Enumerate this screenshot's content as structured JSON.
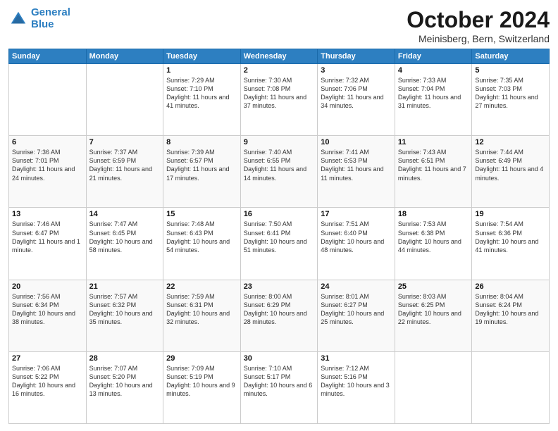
{
  "header": {
    "logo_line1": "General",
    "logo_line2": "Blue",
    "month": "October 2024",
    "location": "Meinisberg, Bern, Switzerland"
  },
  "weekdays": [
    "Sunday",
    "Monday",
    "Tuesday",
    "Wednesday",
    "Thursday",
    "Friday",
    "Saturday"
  ],
  "weeks": [
    [
      {
        "day": "",
        "info": ""
      },
      {
        "day": "",
        "info": ""
      },
      {
        "day": "1",
        "info": "Sunrise: 7:29 AM\nSunset: 7:10 PM\nDaylight: 11 hours and 41 minutes."
      },
      {
        "day": "2",
        "info": "Sunrise: 7:30 AM\nSunset: 7:08 PM\nDaylight: 11 hours and 37 minutes."
      },
      {
        "day": "3",
        "info": "Sunrise: 7:32 AM\nSunset: 7:06 PM\nDaylight: 11 hours and 34 minutes."
      },
      {
        "day": "4",
        "info": "Sunrise: 7:33 AM\nSunset: 7:04 PM\nDaylight: 11 hours and 31 minutes."
      },
      {
        "day": "5",
        "info": "Sunrise: 7:35 AM\nSunset: 7:03 PM\nDaylight: 11 hours and 27 minutes."
      }
    ],
    [
      {
        "day": "6",
        "info": "Sunrise: 7:36 AM\nSunset: 7:01 PM\nDaylight: 11 hours and 24 minutes."
      },
      {
        "day": "7",
        "info": "Sunrise: 7:37 AM\nSunset: 6:59 PM\nDaylight: 11 hours and 21 minutes."
      },
      {
        "day": "8",
        "info": "Sunrise: 7:39 AM\nSunset: 6:57 PM\nDaylight: 11 hours and 17 minutes."
      },
      {
        "day": "9",
        "info": "Sunrise: 7:40 AM\nSunset: 6:55 PM\nDaylight: 11 hours and 14 minutes."
      },
      {
        "day": "10",
        "info": "Sunrise: 7:41 AM\nSunset: 6:53 PM\nDaylight: 11 hours and 11 minutes."
      },
      {
        "day": "11",
        "info": "Sunrise: 7:43 AM\nSunset: 6:51 PM\nDaylight: 11 hours and 7 minutes."
      },
      {
        "day": "12",
        "info": "Sunrise: 7:44 AM\nSunset: 6:49 PM\nDaylight: 11 hours and 4 minutes."
      }
    ],
    [
      {
        "day": "13",
        "info": "Sunrise: 7:46 AM\nSunset: 6:47 PM\nDaylight: 11 hours and 1 minute."
      },
      {
        "day": "14",
        "info": "Sunrise: 7:47 AM\nSunset: 6:45 PM\nDaylight: 10 hours and 58 minutes."
      },
      {
        "day": "15",
        "info": "Sunrise: 7:48 AM\nSunset: 6:43 PM\nDaylight: 10 hours and 54 minutes."
      },
      {
        "day": "16",
        "info": "Sunrise: 7:50 AM\nSunset: 6:41 PM\nDaylight: 10 hours and 51 minutes."
      },
      {
        "day": "17",
        "info": "Sunrise: 7:51 AM\nSunset: 6:40 PM\nDaylight: 10 hours and 48 minutes."
      },
      {
        "day": "18",
        "info": "Sunrise: 7:53 AM\nSunset: 6:38 PM\nDaylight: 10 hours and 44 minutes."
      },
      {
        "day": "19",
        "info": "Sunrise: 7:54 AM\nSunset: 6:36 PM\nDaylight: 10 hours and 41 minutes."
      }
    ],
    [
      {
        "day": "20",
        "info": "Sunrise: 7:56 AM\nSunset: 6:34 PM\nDaylight: 10 hours and 38 minutes."
      },
      {
        "day": "21",
        "info": "Sunrise: 7:57 AM\nSunset: 6:32 PM\nDaylight: 10 hours and 35 minutes."
      },
      {
        "day": "22",
        "info": "Sunrise: 7:59 AM\nSunset: 6:31 PM\nDaylight: 10 hours and 32 minutes."
      },
      {
        "day": "23",
        "info": "Sunrise: 8:00 AM\nSunset: 6:29 PM\nDaylight: 10 hours and 28 minutes."
      },
      {
        "day": "24",
        "info": "Sunrise: 8:01 AM\nSunset: 6:27 PM\nDaylight: 10 hours and 25 minutes."
      },
      {
        "day": "25",
        "info": "Sunrise: 8:03 AM\nSunset: 6:25 PM\nDaylight: 10 hours and 22 minutes."
      },
      {
        "day": "26",
        "info": "Sunrise: 8:04 AM\nSunset: 6:24 PM\nDaylight: 10 hours and 19 minutes."
      }
    ],
    [
      {
        "day": "27",
        "info": "Sunrise: 7:06 AM\nSunset: 5:22 PM\nDaylight: 10 hours and 16 minutes."
      },
      {
        "day": "28",
        "info": "Sunrise: 7:07 AM\nSunset: 5:20 PM\nDaylight: 10 hours and 13 minutes."
      },
      {
        "day": "29",
        "info": "Sunrise: 7:09 AM\nSunset: 5:19 PM\nDaylight: 10 hours and 9 minutes."
      },
      {
        "day": "30",
        "info": "Sunrise: 7:10 AM\nSunset: 5:17 PM\nDaylight: 10 hours and 6 minutes."
      },
      {
        "day": "31",
        "info": "Sunrise: 7:12 AM\nSunset: 5:16 PM\nDaylight: 10 hours and 3 minutes."
      },
      {
        "day": "",
        "info": ""
      },
      {
        "day": "",
        "info": ""
      }
    ]
  ]
}
